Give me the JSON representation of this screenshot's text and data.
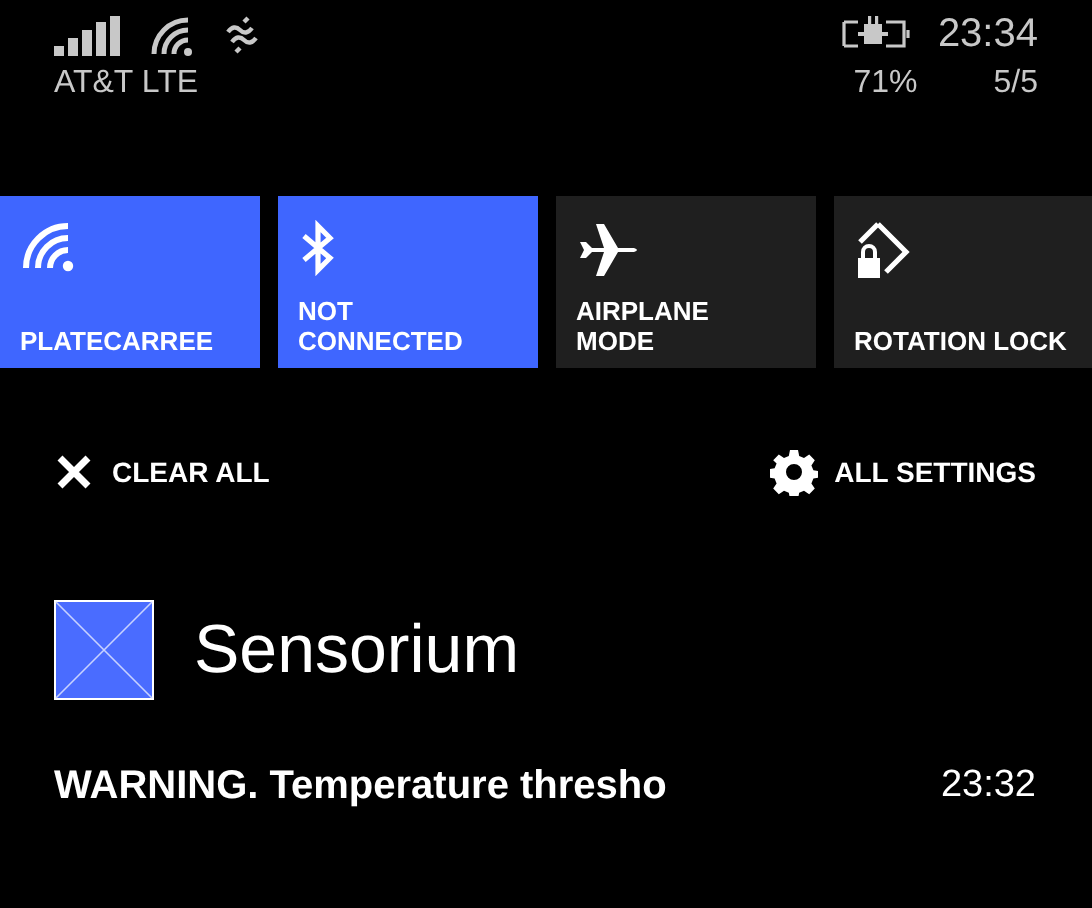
{
  "status_bar": {
    "carrier": "AT&T LTE",
    "battery": "71%",
    "time": "23:34",
    "notifications_count": "5/5"
  },
  "quick_actions": [
    {
      "kind": "wifi",
      "label": "PLATECARREE",
      "on": true
    },
    {
      "kind": "bluetooth",
      "label": "NOT\nCONNECTED",
      "on": true
    },
    {
      "kind": "airplane",
      "label": "AIRPLANE\nMODE",
      "on": false
    },
    {
      "kind": "rotation",
      "label": "ROTATION LOCK",
      "on": false
    }
  ],
  "actions": {
    "clear_all": "CLEAR ALL",
    "all_settings": "ALL SETTINGS"
  },
  "notifications": [
    {
      "app": "Sensorium",
      "message": "WARNING. Temperature thresho",
      "time": "23:32"
    }
  ]
}
